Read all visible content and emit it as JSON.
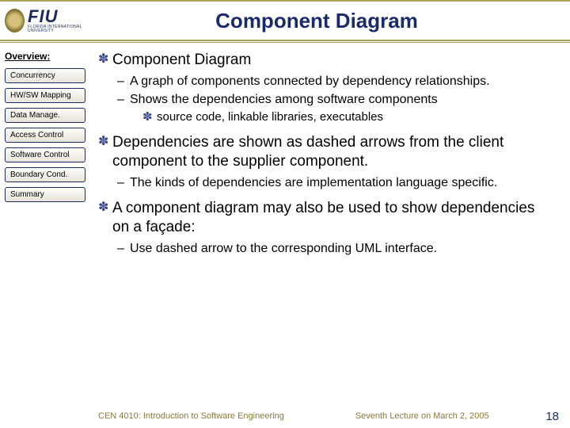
{
  "header": {
    "title": "Component Diagram",
    "logo_big": "FIU",
    "logo_small": "FLORIDA INTERNATIONAL UNIVERSITY"
  },
  "sidebar": {
    "overview_label": "Overview:",
    "items": [
      {
        "label": "Concurrency"
      },
      {
        "label": "HW/SW Mapping"
      },
      {
        "label": "Data Manage."
      },
      {
        "label": "Access Control"
      },
      {
        "label": "Software Control"
      },
      {
        "label": "Boundary Cond."
      },
      {
        "label": "Summary"
      }
    ]
  },
  "bullets": {
    "b1_1": "Component Diagram",
    "b2_1": "A graph of components connected by dependency relationships.",
    "b2_2": "Shows the dependencies among software components",
    "b3_1": "source code, linkable libraries, executables",
    "b1_2": "Dependencies are shown as dashed arrows from the client component to the supplier component.",
    "b2_3": "The kinds of dependencies are implementation language specific.",
    "b1_3": "A component diagram may also be used to show dependencies on a façade:",
    "b2_4": "Use dashed arrow to the corresponding UML interface."
  },
  "footer": {
    "course": "CEN 4010: Introduction to Software Engineering",
    "lecture": "Seventh Lecture on March 2, 2005",
    "page": "18"
  }
}
